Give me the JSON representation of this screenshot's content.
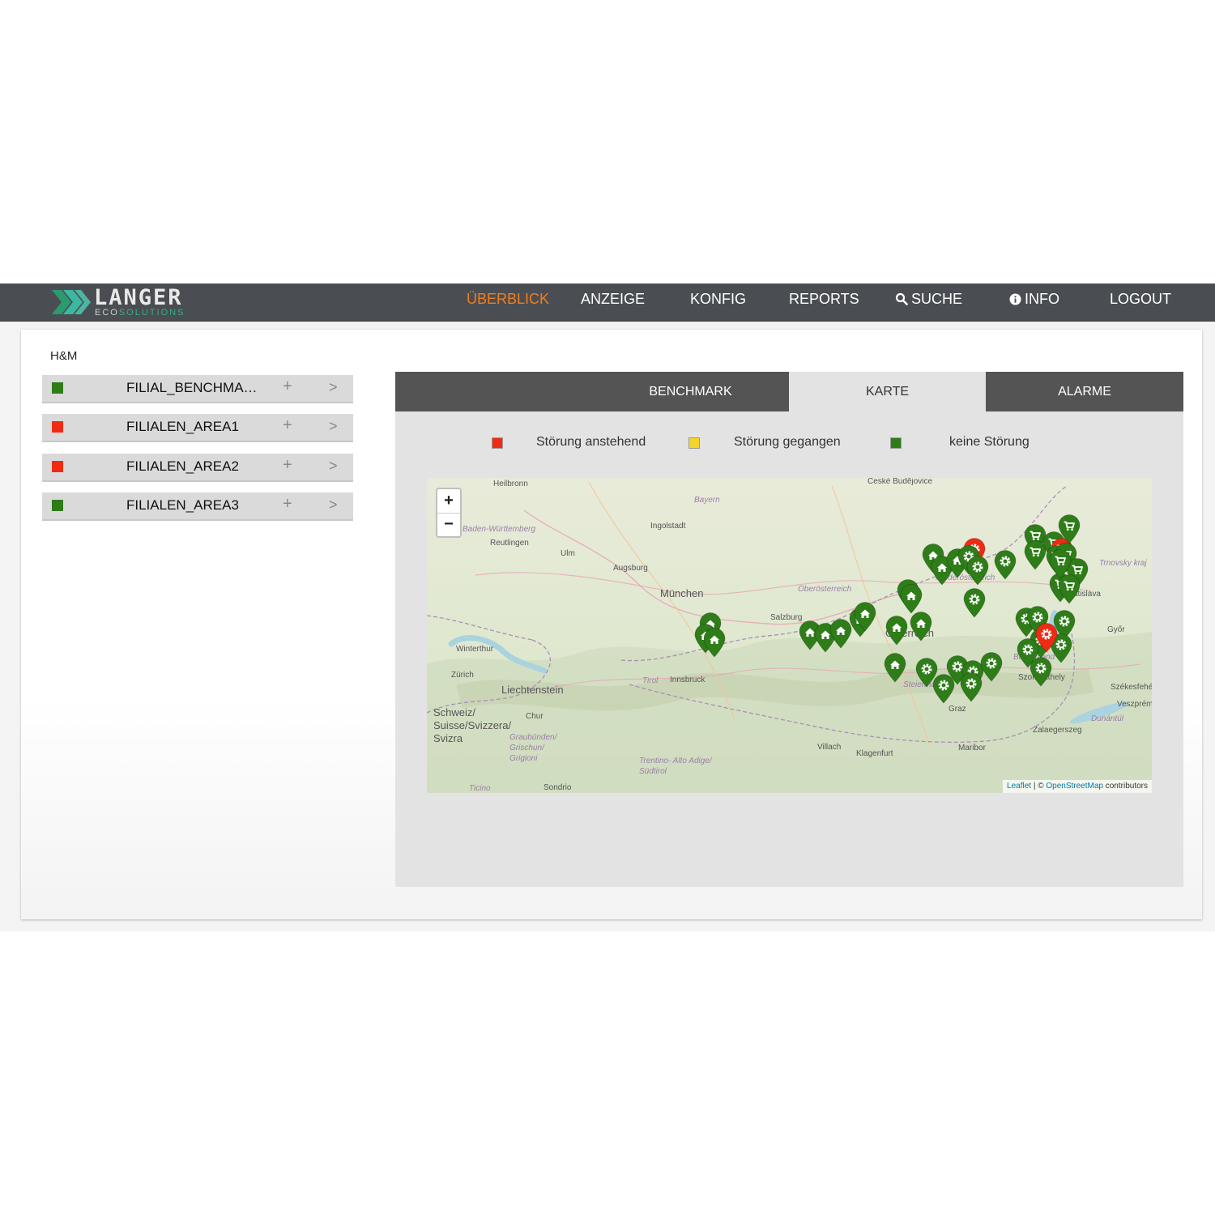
{
  "brand": {
    "wordmark": "LANGER",
    "sub_prefix": "ECO",
    "sub_accent": "SOLUTIONS",
    "colors": {
      "nav_bg": "#4a4e52",
      "accent": "#f07e1e",
      "chevron_green": "#2b9a6e",
      "chevron_teal": "#3bb8a0"
    }
  },
  "nav": {
    "overview": "ÜBERBLICK",
    "display": "ANZEIGE",
    "config": "KONFIG",
    "reports": "REPORTS",
    "search": "SUCHE",
    "info": "INFO",
    "logout": "LOGOUT",
    "active": "overview"
  },
  "customer": "H&M",
  "filialen": [
    {
      "name": "FILIAL_BENCHMA…",
      "status": "green",
      "add": "+",
      "open": ">"
    },
    {
      "name": "FILIALEN_AREA1",
      "status": "red",
      "add": "+",
      "open": ">"
    },
    {
      "name": "FILIALEN_AREA2",
      "status": "red",
      "add": "+",
      "open": ">"
    },
    {
      "name": "FILIALEN_AREA3",
      "status": "green",
      "add": "+",
      "open": ">"
    }
  ],
  "status_colors": {
    "red": "#ee2b14",
    "yellow": "#f4d428",
    "green": "#2e7d19"
  },
  "tabs": [
    {
      "label": "BENCHMARK",
      "active": false
    },
    {
      "label": "KARTE",
      "active": true
    },
    {
      "label": "ALARME",
      "active": false
    }
  ],
  "legend": [
    {
      "label": "Störung anstehend",
      "color": "#ee2b14"
    },
    {
      "label": "Störung gegangen",
      "color": "#f4d428"
    },
    {
      "label": "keine Störung",
      "color": "#2e7d19"
    }
  ],
  "map": {
    "zoom_in": "+",
    "zoom_out": "−",
    "attribution_leaflet": "Leaflet",
    "attribution_sep": " | © ",
    "attribution_osm": "OpenStreetMap",
    "attribution_tail": " contributors",
    "labels": [
      "Heilbronn",
      "Ceské Budějovice",
      "Bayern",
      "Ingolstadt",
      "Baden-Württemberg",
      "Reutlingen",
      "Ulm",
      "Augsburg",
      "München",
      "Oberösterreich",
      "Niederösterreich",
      "Trnovsky kraj",
      "Bratislava",
      "Győr",
      "Winterthur",
      "Zürich",
      "Liechtenstein",
      "Österreich",
      "Burgenland",
      "Szombathely",
      "Székesfehérvár",
      "Veszprém",
      "Steiermark",
      "Tirol",
      "Innsbruck",
      "Salzburg",
      "Schweiz/ Suisse/Svizzera/ Svizra",
      "Chur",
      "Graubünden/ Grischun/ Grigioni",
      "Trentino- Alto Adige/ Südtirol",
      "Dunántúl",
      "Zalaegerszeg",
      "Villach",
      "Klagenfurt",
      "Maribor",
      "Graz",
      "Ticino",
      "Sondrio"
    ],
    "markers": [
      {
        "type": "home",
        "status": "green",
        "lon": 9.52,
        "lat": 47.57
      },
      {
        "type": "home",
        "status": "green",
        "lon": 9.45,
        "lat": 47.44
      },
      {
        "type": "home",
        "status": "green",
        "lon": 9.57,
        "lat": 47.4
      },
      {
        "type": "home",
        "status": "green",
        "lon": 10.82,
        "lat": 47.48
      },
      {
        "type": "home",
        "status": "green",
        "lon": 11.02,
        "lat": 47.45
      },
      {
        "type": "home",
        "status": "green",
        "lon": 11.22,
        "lat": 47.5
      },
      {
        "type": "home",
        "status": "green",
        "lon": 11.48,
        "lat": 47.62
      },
      {
        "type": "home",
        "status": "green",
        "lon": 11.54,
        "lat": 47.68
      },
      {
        "type": "home",
        "status": "green",
        "lon": 12.1,
        "lat": 47.93
      },
      {
        "type": "home",
        "status": "green",
        "lon": 12.15,
        "lat": 47.88
      },
      {
        "type": "home",
        "status": "green",
        "lon": 11.96,
        "lat": 47.53
      },
      {
        "type": "home",
        "status": "green",
        "lon": 12.28,
        "lat": 47.58
      },
      {
        "type": "home",
        "status": "green",
        "lon": 11.94,
        "lat": 47.12
      },
      {
        "type": "home",
        "status": "green",
        "lon": 12.43,
        "lat": 48.32
      },
      {
        "type": "home",
        "status": "green",
        "lon": 12.55,
        "lat": 48.19
      },
      {
        "type": "home",
        "status": "green",
        "lon": 12.75,
        "lat": 48.27
      },
      {
        "type": "gear",
        "status": "red",
        "lon": 12.98,
        "lat": 48.38
      },
      {
        "type": "gear",
        "status": "green",
        "lon": 12.9,
        "lat": 48.3
      },
      {
        "type": "gear",
        "status": "green",
        "lon": 13.02,
        "lat": 48.19
      },
      {
        "type": "gear",
        "status": "green",
        "lon": 13.38,
        "lat": 48.25
      },
      {
        "type": "gear",
        "status": "green",
        "lon": 12.98,
        "lat": 47.83
      },
      {
        "type": "gear",
        "status": "green",
        "lon": 13.66,
        "lat": 47.62
      },
      {
        "type": "gear",
        "status": "green",
        "lon": 13.8,
        "lat": 47.64
      },
      {
        "type": "gear",
        "status": "green",
        "lon": 13.85,
        "lat": 47.39
      },
      {
        "type": "gear",
        "status": "green",
        "lon": 13.68,
        "lat": 47.28
      },
      {
        "type": "gear",
        "status": "green",
        "lon": 13.85,
        "lat": 47.08
      },
      {
        "type": "gear",
        "status": "green",
        "lon": 12.75,
        "lat": 47.1
      },
      {
        "type": "gear",
        "status": "green",
        "lon": 12.35,
        "lat": 47.07
      },
      {
        "type": "gear",
        "status": "green",
        "lon": 12.57,
        "lat": 46.89
      },
      {
        "type": "gear",
        "status": "green",
        "lon": 12.95,
        "lat": 47.04
      },
      {
        "type": "gear",
        "status": "green",
        "lon": 12.93,
        "lat": 46.91
      },
      {
        "type": "gear",
        "status": "green",
        "lon": 13.2,
        "lat": 47.13
      },
      {
        "type": "gear",
        "status": "green",
        "lon": 14.15,
        "lat": 47.59
      },
      {
        "type": "gear",
        "status": "green",
        "lon": 14.11,
        "lat": 47.34
      },
      {
        "type": "gear",
        "status": "red",
        "lon": 13.92,
        "lat": 47.45
      },
      {
        "type": "cart",
        "status": "green",
        "lon": 13.77,
        "lat": 48.53
      },
      {
        "type": "cart",
        "status": "green",
        "lon": 13.77,
        "lat": 48.36
      },
      {
        "type": "cart",
        "status": "green",
        "lon": 14.02,
        "lat": 48.45
      },
      {
        "type": "cart",
        "status": "red",
        "lon": 14.12,
        "lat": 48.38
      },
      {
        "type": "cart",
        "status": "green",
        "lon": 14.06,
        "lat": 48.3
      },
      {
        "type": "cart",
        "status": "green",
        "lon": 14.17,
        "lat": 48.33
      },
      {
        "type": "cart",
        "status": "green",
        "lon": 14.22,
        "lat": 48.64
      },
      {
        "type": "cart",
        "status": "green",
        "lon": 14.32,
        "lat": 48.16
      },
      {
        "type": "cart",
        "status": "green",
        "lon": 14.1,
        "lat": 48.0
      },
      {
        "type": "cart",
        "status": "green",
        "lon": 14.22,
        "lat": 47.98
      },
      {
        "type": "cart",
        "status": "green",
        "lon": 14.1,
        "lat": 48.26
      }
    ]
  }
}
